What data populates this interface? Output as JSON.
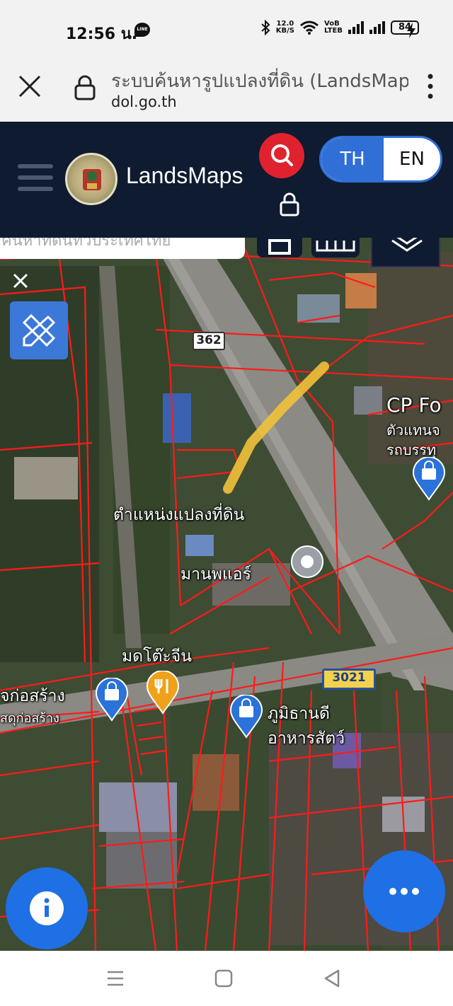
{
  "status_bar": {
    "time": "12:56 น.",
    "line_badge": "LINE",
    "network_speed_value": "12.0",
    "network_speed_unit": "KB/S",
    "volte_top": "VoB",
    "volte_bottom": "LTEB",
    "battery_level": "84"
  },
  "browser": {
    "page_title": "ระบบค้นหารูปแปลงที่ดิน (LandsMaps)",
    "domain": "dol.go.th"
  },
  "app_header": {
    "brand": "LandsMaps",
    "lang_th": "TH",
    "lang_en": "EN",
    "colors": {
      "header_bg": "#0f1b30",
      "search_red": "#e0222f",
      "accent_blue": "#2f6fd6"
    }
  },
  "map": {
    "search_placeholder_fragment": "ค้นหาที่ดินทั่วประเทศไทย",
    "road_shields": {
      "r362": "362",
      "r3021": "3021"
    },
    "labels": {
      "parcel_location": "ตำแหน่งแปลงที่ดิน",
      "cp_line1": "CP Fo",
      "cp_line2": "ตัวแทนจ",
      "cp_line3": "รถบรรทุ",
      "manop_air": "มานพแอร์",
      "table_shop": "มดโต๊ะจีน",
      "construction_1": "จก่อสร้าง",
      "construction_2": "สดุก่อสร้าง",
      "feed_1": "ภูมิธานดี",
      "feed_2": "อาหารสัตว์"
    },
    "colors": {
      "parcel_line": "#ff1a1a",
      "highlight": "#f0c23a",
      "fab_blue": "#1f6fe5"
    }
  }
}
